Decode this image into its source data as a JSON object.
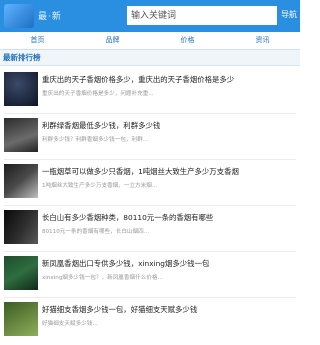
{
  "header": {
    "logo_text": "最·新",
    "search_placeholder": "输入关键词",
    "search_button": "导航"
  },
  "nav": [
    "首页",
    "品牌",
    "价格",
    "资讯"
  ],
  "section_title": "最新排行榜",
  "items": [
    {
      "title": "重庆出的天子香烟价格多少，重庆出的天子香烟价格是多少",
      "desc": "重庆出的天子香烟价格是多少，问题补充重..."
    },
    {
      "title": "利群绿香烟最低多少钱，利群多少钱",
      "desc": "利群多少钱？利群香烟多少钱一包，利群..."
    },
    {
      "title": "一瓶烟草可以做多少只香烟，1吨烟丝大致生产多少万支香烟",
      "desc": "1吨烟丝大致生产多少万支香烟，一立方米烟..."
    },
    {
      "title": "长白山有多少香烟种类，80110元一条的香烟有哪些",
      "desc": "80110元一条的香烟有哪些，长白山烟四..."
    },
    {
      "title": "新凤凰香烟出口专供多少钱，xinxing烟多少钱一包",
      "desc": "xinxing烟多少钱一包？，新凤凰香烟什么价格..."
    },
    {
      "title": "好猫细支香烟多少钱一包，好猫细支天赋多少钱",
      "desc": "好猫细支天赋多少钱..."
    }
  ]
}
